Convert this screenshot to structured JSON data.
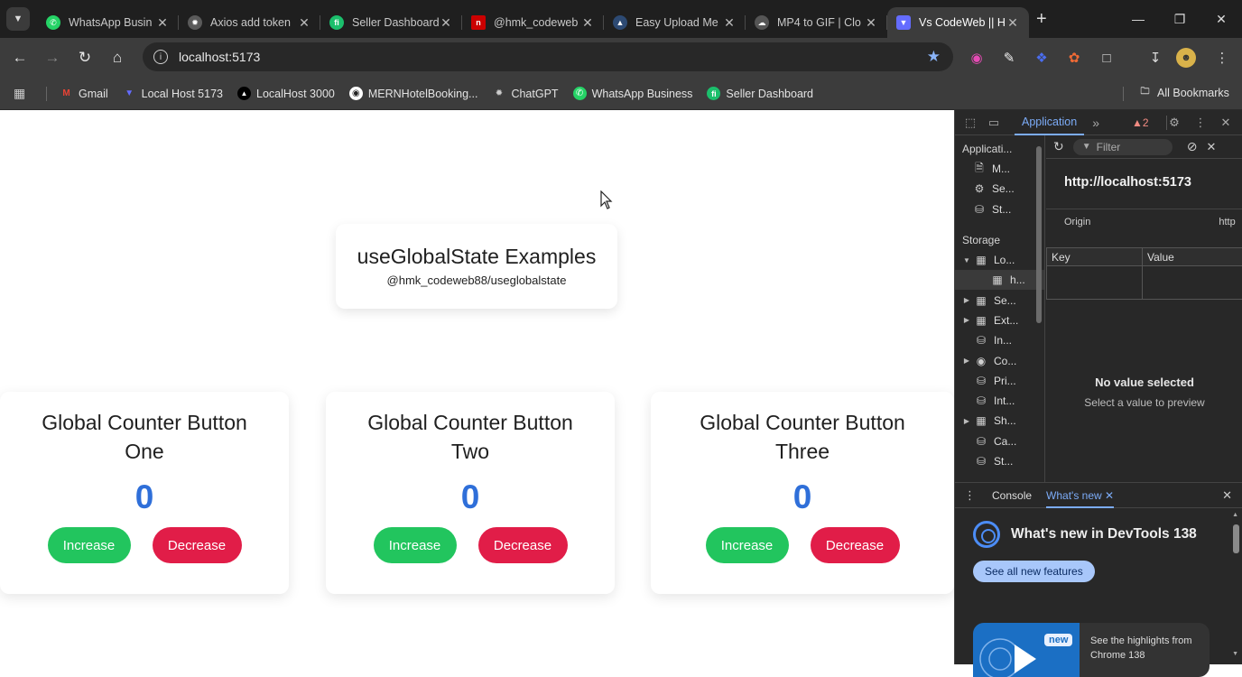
{
  "browser": {
    "tabs": [
      {
        "title": "WhatsApp Busin",
        "icon": "whatsapp-icon",
        "color": "#25d366"
      },
      {
        "title": "Axios add token",
        "icon": "chatgpt-icon",
        "color": "#8e8e8e"
      },
      {
        "title": "Seller Dashboard",
        "icon": "seller-dashboard-icon",
        "color": "#1bbf6c"
      },
      {
        "title": "@hmk_codeweb",
        "icon": "npm-icon",
        "color": "#cb0000"
      },
      {
        "title": "Easy Upload Me",
        "icon": "upload-icon",
        "color": "#6aa5ff"
      },
      {
        "title": "MP4 to GIF | Clo",
        "icon": "cloud-icon",
        "color": "#cfcfcf"
      },
      {
        "title": "Vs CodeWeb || H",
        "icon": "vite-icon",
        "color": "#646cff"
      }
    ],
    "active_tab": 6,
    "address": "localhost:5173",
    "bookmarks": [
      {
        "label": "Gmail",
        "icon": "gmail-icon",
        "color": "#ea4335"
      },
      {
        "label": "Local Host 5173",
        "icon": "vite-icon",
        "color": "#646cff"
      },
      {
        "label": "LocalHost 3000",
        "icon": "nextjs-icon",
        "color": "#000000"
      },
      {
        "label": "MERNHotelBooking...",
        "icon": "github-icon",
        "color": "#ffffff"
      },
      {
        "label": "ChatGPT",
        "icon": "chatgpt-icon",
        "color": "#8e8e8e"
      },
      {
        "label": "WhatsApp Business",
        "icon": "whatsapp-icon",
        "color": "#25d366"
      },
      {
        "label": "Seller Dashboard",
        "icon": "seller-dashboard-icon",
        "color": "#1bbf6c"
      }
    ],
    "all_bookmarks": "All Bookmarks"
  },
  "page": {
    "hero": {
      "title": "useGlobalState Examples",
      "subtitle": "@hmk_codeweb88/useglobalstate"
    },
    "cards": [
      {
        "title_line1": "Global Counter Button",
        "title_line2": "One",
        "count": "0",
        "increase": "Increase",
        "decrease": "Decrease"
      },
      {
        "title_line1": "Global Counter Button",
        "title_line2": "Two",
        "count": "0",
        "increase": "Increase",
        "decrease": "Decrease"
      },
      {
        "title_line1": "Global Counter Button",
        "title_line2": "Three",
        "count": "0",
        "increase": "Increase",
        "decrease": "Decrease"
      }
    ],
    "colors": {
      "count": "#2f6fd9",
      "increase": "#22c55e",
      "decrease": "#e11d48"
    }
  },
  "devtools": {
    "panel_tab": "Application",
    "issues_count": "2",
    "sidebar": {
      "application_header": "Applicati...",
      "app_items": [
        "M...",
        "Se...",
        "St..."
      ],
      "storage_header": "Storage",
      "local_storage": "Lo...",
      "local_child": "h...",
      "storage_items": [
        "Se...",
        "Ext...",
        "In...",
        "Co...",
        "Pri...",
        "Int...",
        "Sh...",
        "Ca...",
        "St..."
      ]
    },
    "filter_placeholder": "Filter",
    "origin_url": "http://localhost:5173",
    "origin_label": "Origin",
    "origin_value": "http",
    "table": {
      "key_header": "Key",
      "value_header": "Value"
    },
    "no_value_title": "No value selected",
    "no_value_sub": "Select a value to preview",
    "drawer": {
      "console_tab": "Console",
      "whats_new_tab": "What's new",
      "heading": "What's new in DevTools 138",
      "button": "See all new features",
      "badge": "new",
      "card_text": "See the highlights from Chrome 138"
    }
  }
}
